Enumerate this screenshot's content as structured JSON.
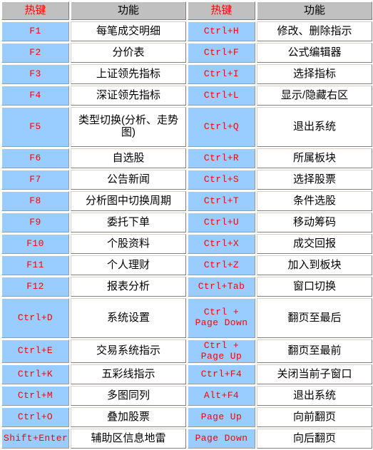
{
  "table": {
    "headers": {
      "hotkey": "热键",
      "function": "功能"
    },
    "colors": {
      "header_bg": "#c0c0c0",
      "hotkey_bg": "#99ccff",
      "function_bg": "#ffffff",
      "hotkey_text": "#ff0000",
      "function_text": "#000000",
      "header_hotkey_text": "#ff0000",
      "header_function_text": "#000000"
    },
    "rows": [
      {
        "tall": false,
        "left_key": "F1",
        "left_fn": "每笔成交明细",
        "right_key": "Ctrl+H",
        "right_fn": "修改、删除指示"
      },
      {
        "tall": false,
        "left_key": "F2",
        "left_fn": "分价表",
        "right_key": "Ctrl+F",
        "right_fn": "公式编辑器"
      },
      {
        "tall": false,
        "left_key": "F3",
        "left_fn": "上证领先指标",
        "right_key": "Ctrl+I",
        "right_fn": "选择指标"
      },
      {
        "tall": false,
        "left_key": "F4",
        "left_fn": "深证领先指标",
        "right_key": "Ctrl+L",
        "right_fn": "显示/隐藏右区"
      },
      {
        "tall": true,
        "left_key": "F5",
        "left_fn": "类型切换(分析、走势图)",
        "right_key": "Ctrl+Q",
        "right_fn": "退出系统"
      },
      {
        "tall": false,
        "left_key": "F6",
        "left_fn": "自选股",
        "right_key": "Ctrl+R",
        "right_fn": "所属板块"
      },
      {
        "tall": false,
        "left_key": "F7",
        "left_fn": "公告新闻",
        "right_key": "Ctrl+S",
        "right_fn": "选择股票"
      },
      {
        "tall": false,
        "left_key": "F8",
        "left_fn": "分析图中切换周期",
        "right_key": "Ctrl+T",
        "right_fn": "条件选股"
      },
      {
        "tall": false,
        "left_key": "F9",
        "left_fn": "委托下单",
        "right_key": "Ctrl+U",
        "right_fn": "移动筹码"
      },
      {
        "tall": false,
        "left_key": "F10",
        "left_fn": "个股资料",
        "right_key": "Ctrl+X",
        "right_fn": "成交回报"
      },
      {
        "tall": false,
        "left_key": "F11",
        "left_fn": "个人理财",
        "right_key": "Ctrl+Z",
        "right_fn": "加入到板块"
      },
      {
        "tall": false,
        "left_key": "F12",
        "left_fn": "报表分析",
        "right_key": "Ctrl+Tab",
        "right_fn": "窗口切换"
      },
      {
        "tall": true,
        "left_key": "Ctrl+D",
        "left_fn": "系统设置",
        "right_key": "Ctrl + Page Down",
        "right_fn": "翻页至最后"
      },
      {
        "tall": false,
        "left_key": "Ctrl+E",
        "left_fn": "交易系统指示",
        "right_key": "Ctrl + Page Up",
        "right_fn": "翻页至最前"
      },
      {
        "tall": false,
        "left_key": "Ctrl+K",
        "left_fn": "五彩线指示",
        "right_key": "Ctrl+F4",
        "right_fn": "关闭当前子窗口"
      },
      {
        "tall": false,
        "left_key": "Ctrl+M",
        "left_fn": "多图同列",
        "right_key": "Alt+F4",
        "right_fn": "退出系统"
      },
      {
        "tall": false,
        "left_key": "Ctrl+O",
        "left_fn": "叠加股票",
        "right_key": "Page Up",
        "right_fn": "向前翻页"
      },
      {
        "tall": false,
        "left_key": "Shift+Enter",
        "left_fn": "辅助区信息地雷",
        "right_key": "Page Down",
        "right_fn": "向后翻页"
      }
    ]
  }
}
